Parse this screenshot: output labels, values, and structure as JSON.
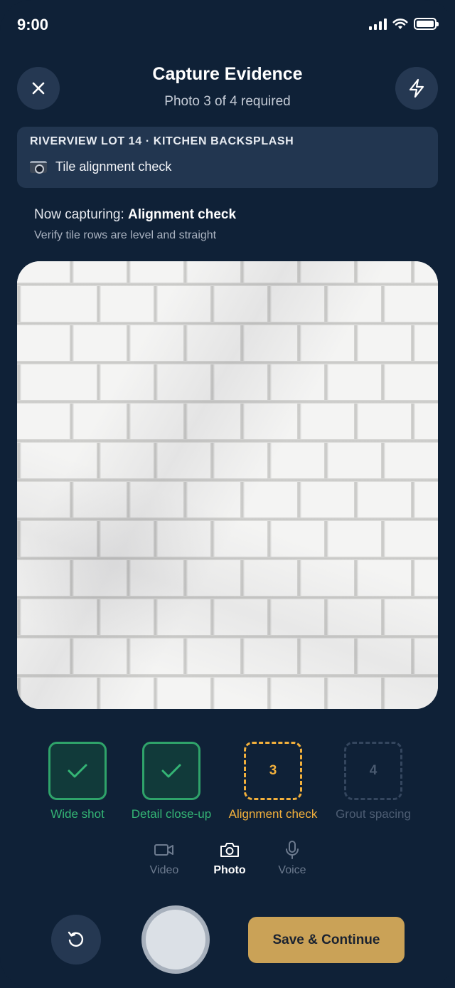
{
  "status_bar": {
    "time": "9:00"
  },
  "header": {
    "title": "Capture Evidence",
    "subtitle": "Photo 3 of 4 required"
  },
  "job": {
    "project": "RIVERVIEW LOT 14 · KITCHEN BACKSPLASH",
    "task": "Tile alignment check",
    "task_icon": "camera-icon"
  },
  "capture": {
    "prefix": "Now capturing: ",
    "current_step": "Alignment check",
    "hint": "Verify tile rows are level and straight"
  },
  "steps": [
    {
      "label": "Wide shot",
      "state": "done",
      "number": ""
    },
    {
      "label": "Detail close-up",
      "state": "done",
      "number": ""
    },
    {
      "label": "Alignment check",
      "state": "current",
      "number": "3"
    },
    {
      "label": "Grout spacing",
      "state": "pending",
      "number": "4"
    }
  ],
  "modes": [
    {
      "label": "Video",
      "icon": "video-icon",
      "active": false
    },
    {
      "label": "Photo",
      "icon": "camera-icon",
      "active": true
    },
    {
      "label": "Voice",
      "icon": "microphone-icon",
      "active": false
    }
  ],
  "actions": {
    "save_label": "Save & Continue"
  },
  "colors": {
    "background": "#0f2137",
    "done": "#2fa36a",
    "current": "#f2b03c",
    "pending": "#4d5d73",
    "primary_button": "#caa257"
  }
}
